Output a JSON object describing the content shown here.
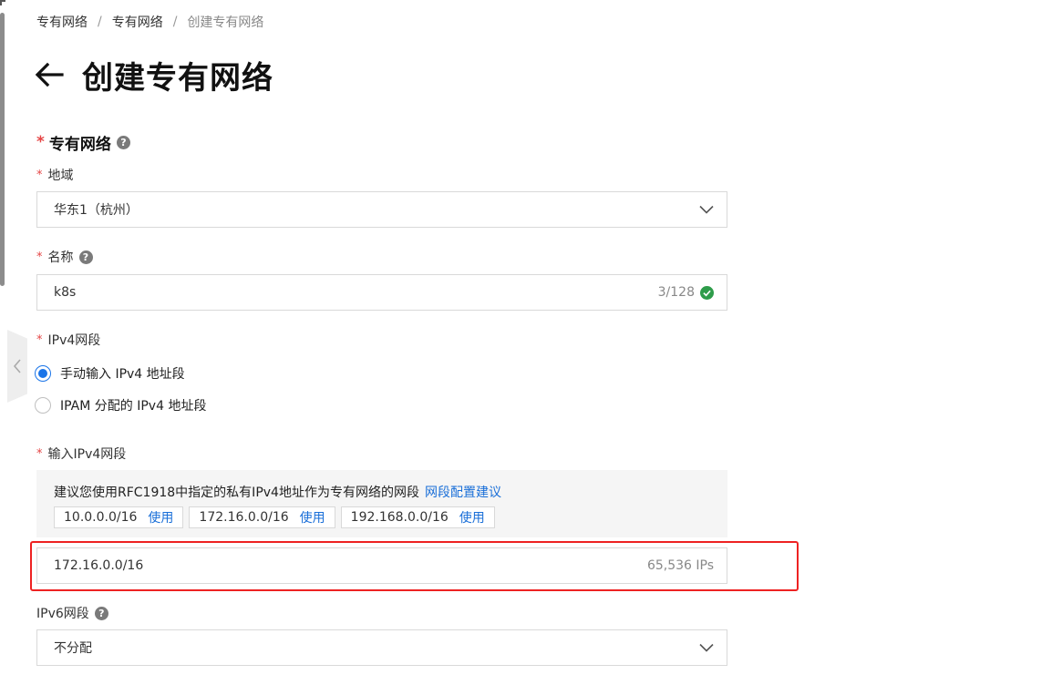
{
  "breadcrumb": {
    "items": [
      "专有网络",
      "专有网络",
      "创建专有网络"
    ],
    "separator": "/"
  },
  "page": {
    "title": "创建专有网络"
  },
  "section": {
    "title": "专有网络",
    "required_mark": "*"
  },
  "region": {
    "label": "地域",
    "value": "华东1（杭州）"
  },
  "name": {
    "label": "名称",
    "value": "k8s",
    "counter": "3/128"
  },
  "ipv4_mode": {
    "label": "IPv4网段",
    "options": [
      "手动输入 IPv4 地址段",
      "IPAM 分配的 IPv4 地址段"
    ],
    "selected_index": 0
  },
  "ipv4_input": {
    "label": "输入IPv4网段",
    "suggestion_text": "建议您使用RFC1918中指定的私有IPv4地址作为专有网络的网段",
    "suggestion_link": "网段配置建议",
    "presets": [
      {
        "cidr": "10.0.0.0/16",
        "action": "使用"
      },
      {
        "cidr": "172.16.0.0/16",
        "action": "使用"
      },
      {
        "cidr": "192.168.0.0/16",
        "action": "使用"
      }
    ],
    "value": "172.16.0.0/16",
    "ip_count": "65,536 IPs"
  },
  "ipv6": {
    "label": "IPv6网段",
    "value": "不分配"
  },
  "colors": {
    "primary": "#1a74e8",
    "link": "#1a6fd8",
    "required": "#e54545",
    "success": "#2e9c4a",
    "highlight_border": "#ee2222"
  },
  "help_icon_glyph": "?"
}
